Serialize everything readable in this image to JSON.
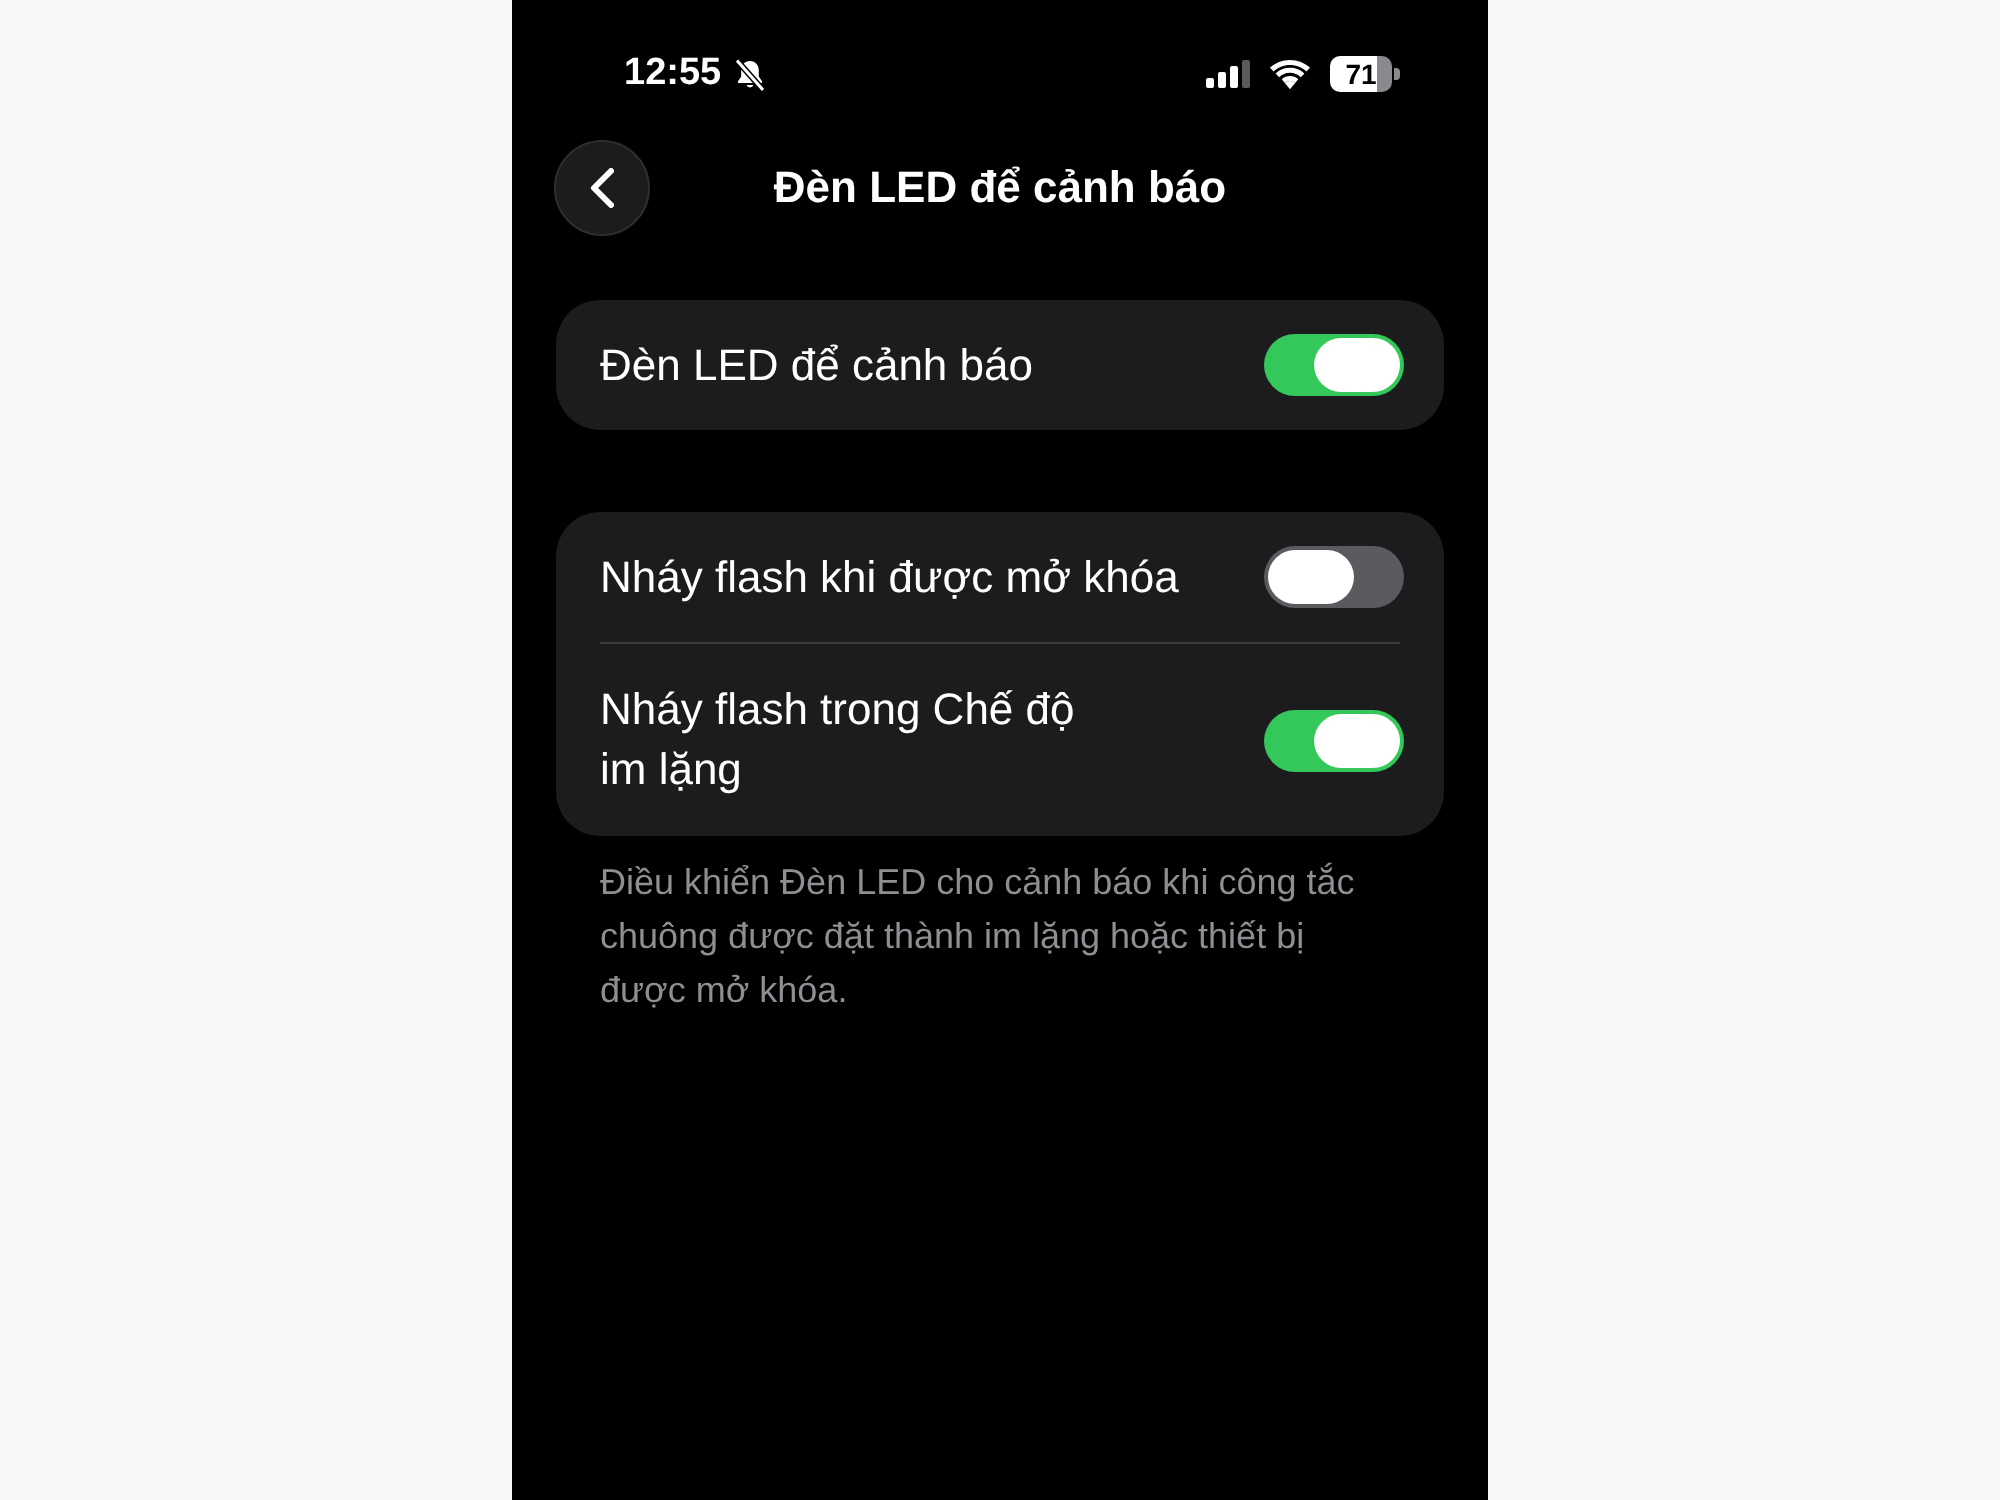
{
  "status_bar": {
    "time": "12:55",
    "battery": "71"
  },
  "nav": {
    "title": "Đèn LED để cảnh báo"
  },
  "groups": [
    {
      "rows": [
        {
          "label": "Đèn LED để cảnh báo",
          "on": true
        }
      ]
    },
    {
      "rows": [
        {
          "label": "Nháy flash khi được mở khóa",
          "on": false
        },
        {
          "label": "Nháy flash trong Chế độ\nim lặng",
          "on": true
        }
      ],
      "footer": "Điều khiển Đèn LED cho cảnh báo khi công tắc chuông được đặt thành im lặng hoặc thiết bị được mở khóa."
    }
  ]
}
